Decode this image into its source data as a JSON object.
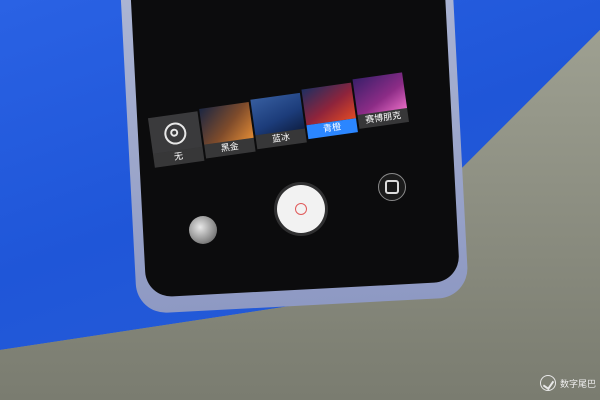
{
  "camera": {
    "filters": [
      {
        "id": "none",
        "label": "无",
        "icon": "none-circle-icon"
      },
      {
        "id": "f1",
        "label": "黑金"
      },
      {
        "id": "f2",
        "label": "蓝冰"
      },
      {
        "id": "f3",
        "label": "青橙",
        "selected": true
      },
      {
        "id": "f4",
        "label": "赛博朋克"
      }
    ]
  },
  "colors": {
    "accent": "#2b86ff",
    "background_blue": "#245ddc"
  },
  "watermark": {
    "text": "数字尾巴"
  }
}
